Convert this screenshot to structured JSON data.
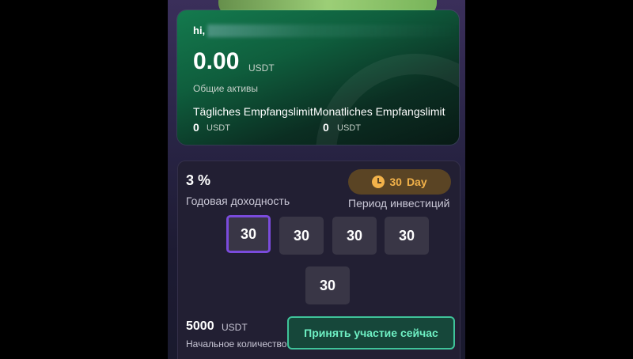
{
  "assets": {
    "greeting": "hi,",
    "balance": "0.00",
    "balance_unit": "USDT",
    "total_label": "Общие активы",
    "daily_title": "Tägliches Empfangslimit",
    "daily_value": "0",
    "daily_unit": "USDT",
    "monthly_title": "Monatliches Empfangslimit",
    "monthly_value": "0",
    "monthly_unit": "USDT"
  },
  "product": {
    "rate": "3 %",
    "rate_label": "Годовая доходность",
    "period_value": "30",
    "period_unit": "Day",
    "period_label": "Период инвестиций",
    "options": [
      "30",
      "30",
      "30",
      "30",
      "30"
    ],
    "selected_index": 0,
    "amount": "5000",
    "amount_unit": "USDT",
    "amount_label": "Начальное количество",
    "join_label": "Принять участие сейчас"
  },
  "colors": {
    "accent_purple": "#7a4bdc",
    "accent_green": "#3fc39a",
    "accent_gold": "#f2b24a"
  }
}
